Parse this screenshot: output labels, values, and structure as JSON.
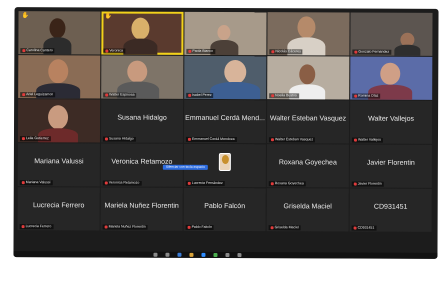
{
  "participants": [
    {
      "label": "Carolina Cantero",
      "big": "",
      "video": true,
      "hand": true
    },
    {
      "label": "Veronica",
      "big": "",
      "video": true,
      "hand": true,
      "speaking": true
    },
    {
      "label": "Paola Bianco",
      "big": "",
      "video": true
    },
    {
      "label": "Nicolás Cáceres",
      "big": "",
      "video": true
    },
    {
      "label": "Gonzalo Fernandez",
      "big": "",
      "video": true
    },
    {
      "label": "Ariel Leguizamon",
      "big": "",
      "video": true
    },
    {
      "label": "Walter Espinosa",
      "big": "",
      "video": true
    },
    {
      "label": "Isabel Perez",
      "big": "",
      "video": true
    },
    {
      "label": "Noelia Bustos",
      "big": "",
      "video": true
    },
    {
      "label": "Romina Díaz",
      "big": "",
      "video": true
    },
    {
      "label": "Leila Gutierrez",
      "big": "",
      "video": true
    },
    {
      "label": "Susana Hidalgo",
      "big": "Susana Hidalgo",
      "video": false
    },
    {
      "label": "Emmanuel Cerdá Mendoza",
      "big": "Emmanuel Cerdá Mend...",
      "video": false
    },
    {
      "label": "Walter Esteban Vasquez",
      "big": "Walter Esteban Vasquez",
      "video": false
    },
    {
      "label": "Walter Vallejos",
      "big": "Walter Vallejos",
      "video": false
    },
    {
      "label": "Mariana Valussi",
      "big": "Mariana Valussi",
      "video": false
    },
    {
      "label": "Veronica Retamozo",
      "big": "Veronica Retamozo",
      "video": false
    },
    {
      "label": "Lucrecia Fernández",
      "big": "",
      "video": false,
      "avatar": true
    },
    {
      "label": "Roxana Goyechea",
      "big": "Roxana Goyechea",
      "video": false
    },
    {
      "label": "Javier Florentin",
      "big": "Javier Florentin",
      "video": false
    },
    {
      "label": "Lucrecia Ferrero",
      "big": "Lucrecia Ferrero",
      "video": false
    },
    {
      "label": "Mariela Nuñez Florentin",
      "big": "Mariela Nuñez Florentin",
      "video": false
    },
    {
      "label": "Pablo Falcón",
      "big": "Pablo Falcón",
      "video": false
    },
    {
      "label": "Griselda Maciel",
      "big": "Griselda Maciel",
      "video": false
    },
    {
      "label": "CD931451",
      "big": "CD931451",
      "video": false
    }
  ],
  "tooltip": "Silenciar con tecla espacio",
  "colors": {
    "speaking": "#f2d21b",
    "muted": "#e03b3b",
    "tile": "#262626"
  }
}
